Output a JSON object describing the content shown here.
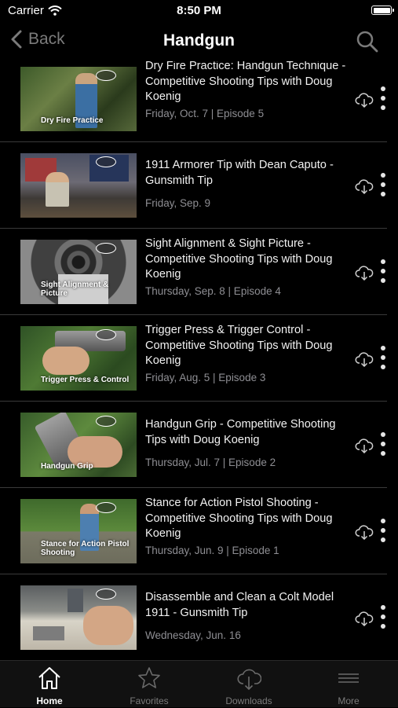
{
  "status_bar": {
    "carrier": "Carrier",
    "time": "8:50 PM"
  },
  "nav": {
    "back_label": "Back",
    "title": "Handgun"
  },
  "episodes": [
    {
      "title": "Dry Fire Practice: Handgun Technique - Competitive Shooting Tips with Doug Koenig",
      "meta": "Friday, Oct. 7 | Episode 5",
      "thumb_caption": "Dry Fire Practice"
    },
    {
      "title": "1911 Armorer Tip with Dean Caputo - Gunsmith Tip",
      "meta": "Friday, Sep. 9",
      "thumb_caption": ""
    },
    {
      "title": "Sight Alignment & Sight Picture - Competitive Shooting Tips with Doug Koenig",
      "meta": "Thursday, Sep. 8 | Episode 4",
      "thumb_caption": "Sight Alignment & Picture"
    },
    {
      "title": "Trigger Press & Trigger Control - Competitive Shooting Tips with Doug Koenig",
      "meta": "Friday, Aug. 5 | Episode 3",
      "thumb_caption": "Trigger Press & Control"
    },
    {
      "title": "Handgun Grip - Competitive Shooting Tips with Doug Koenig",
      "meta": "Thursday, Jul. 7 | Episode 2",
      "thumb_caption": "Handgun Grip"
    },
    {
      "title": "Stance for Action Pistol Shooting - Competitive Shooting Tips with Doug Koenig",
      "meta": "Thursday, Jun. 9 | Episode 1",
      "thumb_caption": "Stance for Action Pistol Shooting"
    },
    {
      "title": "Disassemble and Clean a Colt Model 1911 - Gunsmith Tip",
      "meta": "Wednesday, Jun. 16",
      "thumb_caption": ""
    }
  ],
  "tabs": [
    {
      "label": "Home",
      "icon": "home-icon",
      "active": true
    },
    {
      "label": "Favorites",
      "icon": "star-icon",
      "active": false
    },
    {
      "label": "Downloads",
      "icon": "cloud-download-icon",
      "active": false
    },
    {
      "label": "More",
      "icon": "menu-lines-icon",
      "active": false
    }
  ],
  "colors": {
    "background": "#000000",
    "muted": "#8e8e93",
    "nav_gray": "#7b7b7b"
  }
}
